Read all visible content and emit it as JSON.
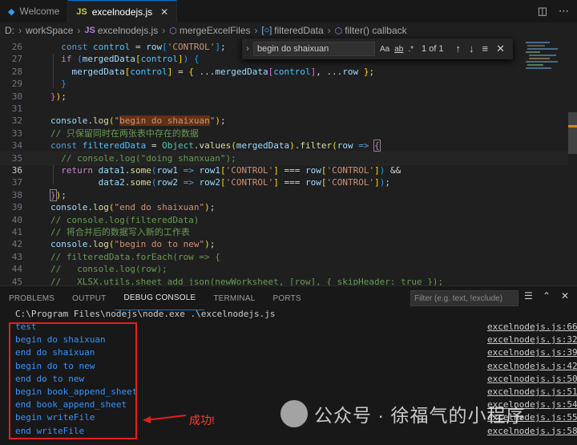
{
  "tabs": [
    {
      "label": "Welcome",
      "active": false
    },
    {
      "label": "excelnodejs.js",
      "active": true,
      "icon": "JS"
    }
  ],
  "breadcrumb": [
    "D:",
    "workSpace",
    "excelnodejs.js",
    "mergeExcelFiles",
    "filteredData",
    "filter() callback"
  ],
  "find_widget": {
    "query": "begin do shaixuan",
    "options": [
      "Aa",
      "ab",
      ".*"
    ],
    "count": "1 of 1"
  },
  "line_numbers": [
    "26",
    "27",
    "28",
    "29",
    "30",
    "31",
    "32",
    "33",
    "34",
    "35",
    "36",
    "37",
    "38",
    "39",
    "40",
    "41",
    "42",
    "43",
    "44",
    "45"
  ],
  "current_line": "36",
  "panel": {
    "tabs": [
      "PROBLEMS",
      "OUTPUT",
      "DEBUG CONSOLE",
      "TERMINAL",
      "PORTS"
    ],
    "active_tab": "DEBUG CONSOLE",
    "filter_placeholder": "Filter (e.g. text, !exclude)",
    "command": "C:\\Program Files\\nodejs\\node.exe .\\excelnodejs.js",
    "output": [
      {
        "text": "test",
        "source": "excelnodejs.js:66"
      },
      {
        "text": "begin do shaixuan",
        "source": "excelnodejs.js:32"
      },
      {
        "text": "end do shaixuan",
        "source": "excelnodejs.js:39"
      },
      {
        "text": "begin do to new",
        "source": "excelnodejs.js:42"
      },
      {
        "text": "end do to new",
        "source": "excelnodejs.js:50"
      },
      {
        "text": "begin book_append_sheet",
        "source": "excelnodejs.js:51"
      },
      {
        "text": "end book_append_sheet",
        "source": "excelnodejs.js:54"
      },
      {
        "text": "begin writeFile",
        "source": "excelnodejs.js:55"
      },
      {
        "text": "end writeFile",
        "source": "excelnodejs.js:58"
      }
    ]
  },
  "annotation": "成功!",
  "watermark": "公众号 · 徐福气的小程序",
  "colors": {
    "accent": "#0078d4",
    "annotation": "#e02020",
    "console_text": "#3794ff",
    "search_highlight": "#613214"
  }
}
